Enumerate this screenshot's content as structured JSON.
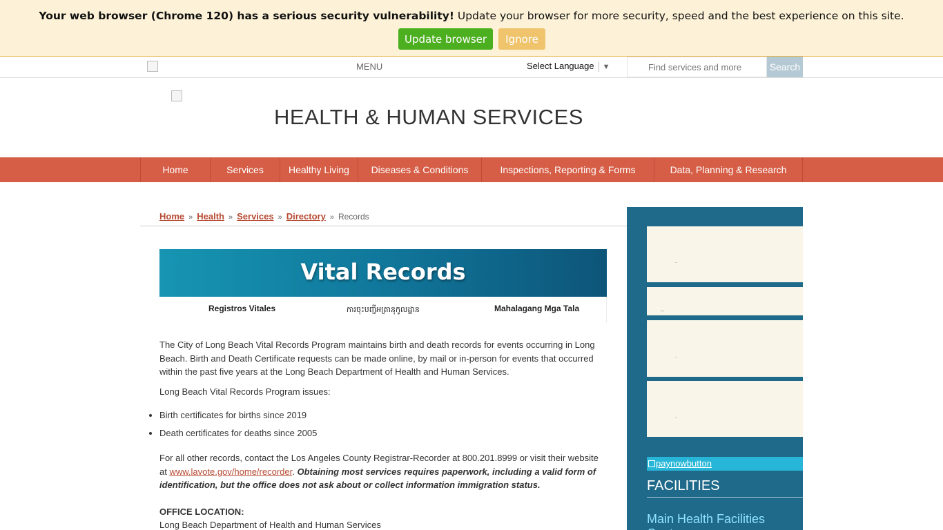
{
  "update_banner": {
    "bold_text": "Your web browser (Chrome 120) has a serious security vulnerability!",
    "text": " Update your browser for more security, speed and the best experience on this site.",
    "update_label": "Update browser",
    "ignore_label": "Ignore"
  },
  "utility": {
    "menu_label": "MENU",
    "language_label": "Select Language",
    "language_arrow": "▼",
    "search_placeholder": "Find services and more",
    "search_button": "Search"
  },
  "header": {
    "title": "HEALTH & HUMAN SERVICES"
  },
  "nav": {
    "items": [
      "Home",
      "Services",
      "Healthy Living",
      "Diseases & Conditions",
      "Inspections, Reporting & Forms",
      "Data, Planning & Research"
    ]
  },
  "breadcrumb": {
    "links": [
      "Home",
      "Health",
      "Services",
      "Directory"
    ],
    "separator": "»",
    "current": "Records"
  },
  "vital_records": {
    "title": "Vital Records",
    "lang_spanish": "Registros Vitales",
    "lang_khmer": "ការចុះបញ្ជីអត្រានុកូលដ្ឋាន",
    "lang_tagalog": "Mahalagang Mga Tala"
  },
  "content": {
    "intro": "The City of Long Beach Vital Records Program maintains birth and death records for events occurring in Long Beach. Birth and Death Certificate requests can be made online, by mail or in-person for events that occurred within the past five years at the Long Beach Department of Health and Human Services.",
    "issues_heading": "Long Beach Vital Records Program issues:",
    "issues": [
      "Birth certificates for births since 2019",
      "Death certificates for deaths since 2005"
    ],
    "other_records_prefix": "For all other records, contact the Los Angeles County Registrar-Recorder at 800.201.8999 or visit their website at ",
    "other_records_link": "www.lavote.gov/home/recorder",
    "other_records_suffix": ". ",
    "paperwork_note": "Obtaining most services requires paperwork, including a valid form of identification, but the office does not ask about or collect information immigration status.",
    "office_heading": "OFFICE LOCATION:",
    "office_name": "Long Beach Department of Health and Human Services"
  },
  "sidebar": {
    "card_marks": [
      "-",
      "_",
      "-",
      "-"
    ],
    "paynow_alt": "paynowbutton",
    "facilities_title": "FACILITIES",
    "facility_link": "Main Health Facilities Center"
  },
  "colors": {
    "banner_bg": "#fdf2d7",
    "update_button": "#4caf1f",
    "ignore_button": "#f0c46d",
    "nav_bg": "#d65e47",
    "link": "#b84a33",
    "sidebar_bg": "#1f6a8a",
    "card_bg": "#f9f6e9",
    "paynow_bg": "#27b6d7",
    "facility_link": "#8fe2ff"
  }
}
